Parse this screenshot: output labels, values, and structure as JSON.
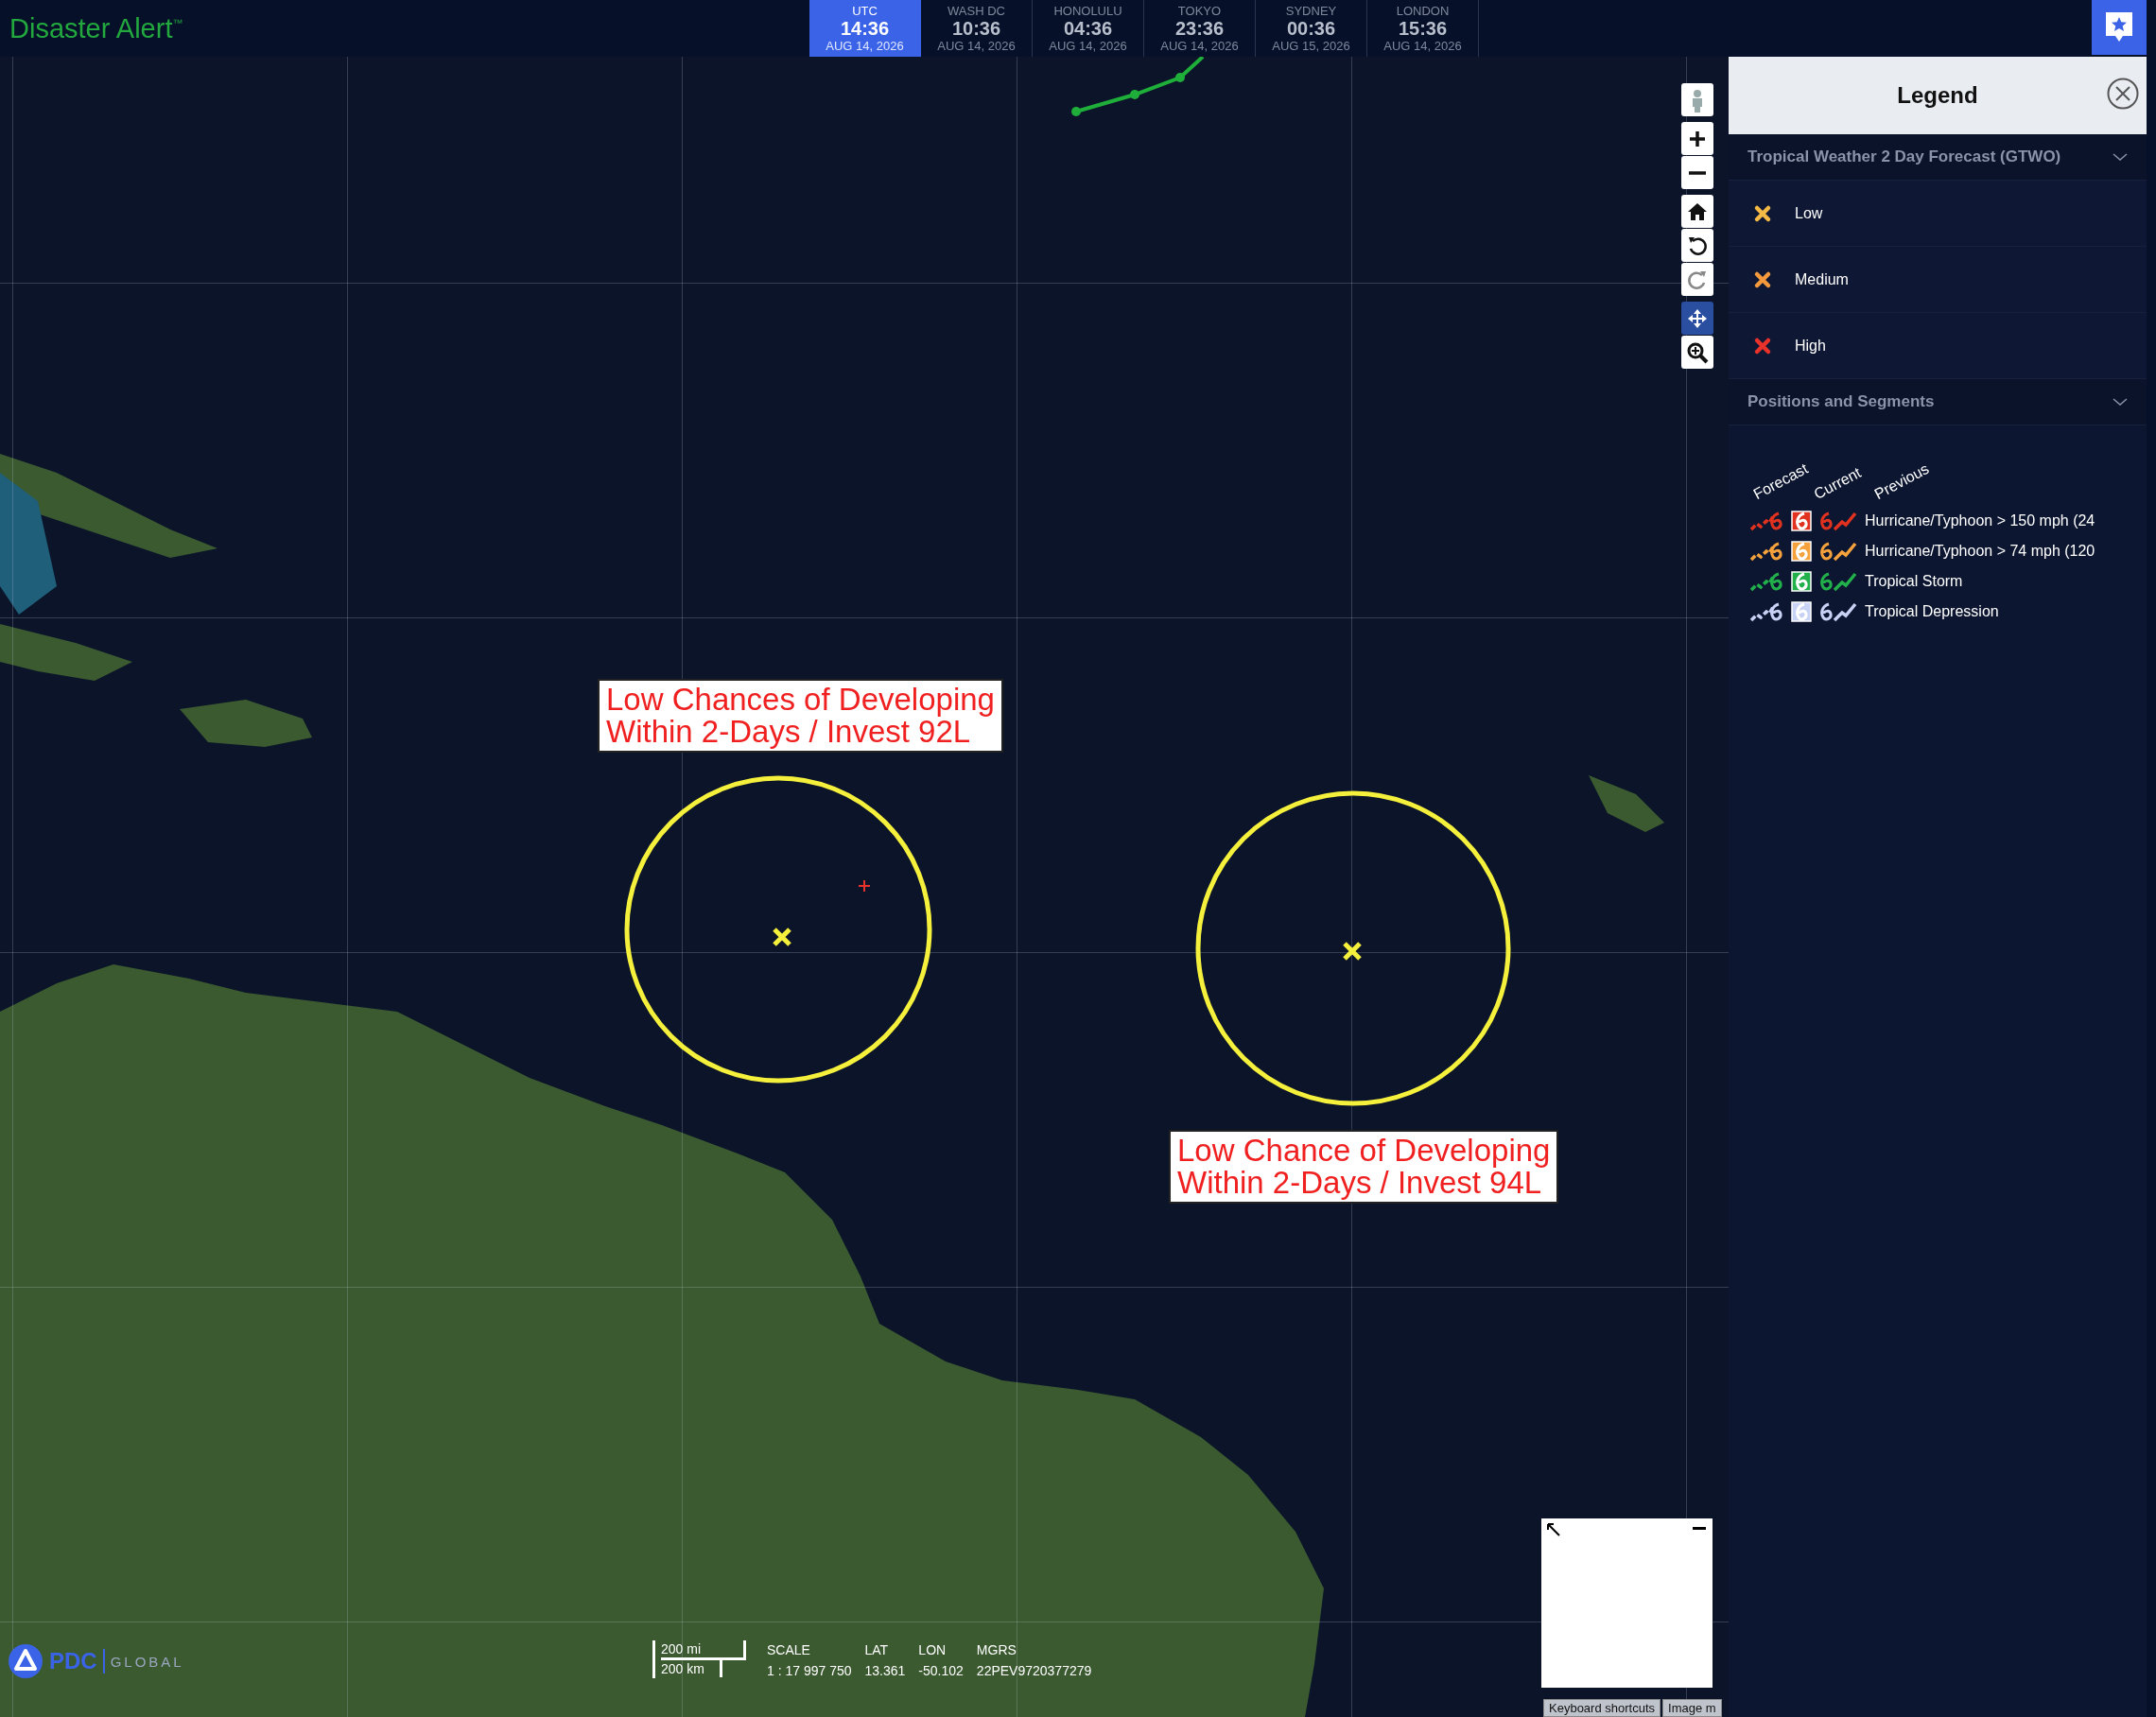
{
  "app": {
    "title": "Disaster Alert",
    "trademark": "™"
  },
  "clocks": [
    {
      "city": "UTC",
      "time": "14:36",
      "date": "AUG 14, 2026",
      "selected": true
    },
    {
      "city": "WASH DC",
      "time": "10:36",
      "date": "AUG 14, 2026",
      "selected": false
    },
    {
      "city": "HONOLULU",
      "time": "04:36",
      "date": "AUG 14, 2026",
      "selected": false
    },
    {
      "city": "TOKYO",
      "time": "23:36",
      "date": "AUG 14, 2026",
      "selected": false
    },
    {
      "city": "SYDNEY",
      "time": "00:36",
      "date": "AUG 15, 2026",
      "selected": false
    },
    {
      "city": "LONDON",
      "time": "15:36",
      "date": "AUG 14, 2026",
      "selected": false
    }
  ],
  "map": {
    "annotations": [
      {
        "lines": [
          "Low Chances of Developing",
          "Within 2-Days / Invest 92L"
        ]
      },
      {
        "lines": [
          "Low Chance of Developing",
          "Within 2-Days / Invest 94L"
        ]
      }
    ]
  },
  "map_controls": [
    {
      "kind": "person",
      "selected": false
    },
    {
      "kind": "zoom-in",
      "selected": false
    },
    {
      "kind": "zoom-out",
      "selected": false
    },
    {
      "kind": "home",
      "selected": false
    },
    {
      "kind": "rotate-left",
      "selected": false
    },
    {
      "kind": "rotate-right",
      "selected": false
    },
    {
      "kind": "pan",
      "selected": true
    },
    {
      "kind": "zoom-box",
      "selected": false
    }
  ],
  "legend": {
    "title": "Legend",
    "sections": [
      {
        "title": "Tropical Weather 2 Day Forecast (GTWO)",
        "expanded": true,
        "items": [
          {
            "label": "Low",
            "color": "#f5b945"
          },
          {
            "label": "Medium",
            "color": "#f59a3c"
          },
          {
            "label": "High",
            "color": "#e8322a"
          }
        ]
      },
      {
        "title": "Positions and Segments",
        "expanded": true,
        "columns": [
          "Forecast",
          "Current",
          "Previous"
        ],
        "rows": [
          {
            "label": "Hurricane/Typhoon > 150 mph (24",
            "color": "#e0321f"
          },
          {
            "label": "Hurricane/Typhoon > 74 mph (120",
            "color": "#f5a23c"
          },
          {
            "label": "Tropical Storm",
            "color": "#22b04a"
          },
          {
            "label": "Tropical Depression",
            "color": "#c8d2f5"
          }
        ]
      }
    ]
  },
  "logo": {
    "name": "PDC",
    "sub": "GLOBAL"
  },
  "scale_bar": {
    "miles": "200 mi",
    "km": "200 km"
  },
  "readouts": [
    {
      "label": "SCALE",
      "value": "1 : 17 997 750"
    },
    {
      "label": "LAT",
      "value": "13.361"
    },
    {
      "label": "LON",
      "value": "-50.102"
    },
    {
      "label": "MGRS",
      "value": "22PEV9720377279"
    }
  ],
  "footer_buttons": [
    "Keyboard shortcuts",
    "Image m"
  ]
}
